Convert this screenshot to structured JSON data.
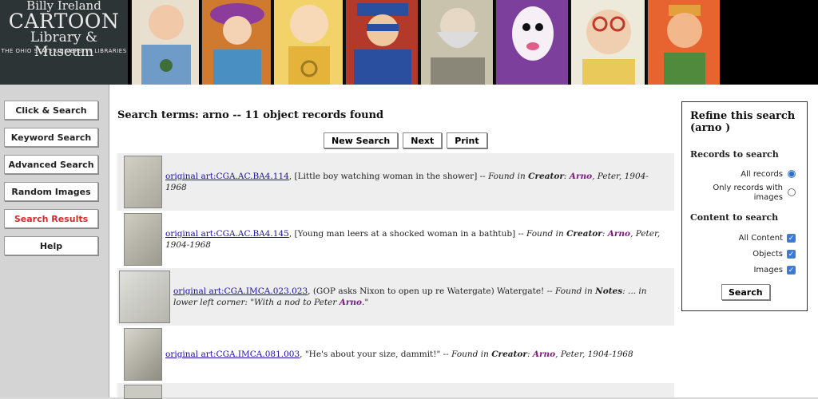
{
  "logo": {
    "line1": "Billy Ireland",
    "line2": "CARTOON",
    "line3": "Library & Museum",
    "line4": "THE OHIO STATE UNIVERSITY LIBRARIES"
  },
  "nav": [
    {
      "label": "Click & Search",
      "active": false
    },
    {
      "label": "Keyword Search",
      "active": false
    },
    {
      "label": "Advanced Search",
      "active": false
    },
    {
      "label": "Random Images",
      "active": false
    },
    {
      "label": "Search Results",
      "active": true
    },
    {
      "label": "Help",
      "active": false
    }
  ],
  "heading": "Search terms: arno -- 11 object records found",
  "buttons": {
    "new_search": "New Search",
    "next": "Next",
    "print": "Print"
  },
  "results": [
    {
      "link": "original art:CGA.AC.BA4.114",
      "desc": ", [Little boy watching woman in the shower] -- ",
      "found": "Found in ",
      "field": "Creator",
      "sep": ": ",
      "hl": "Arno",
      "tail": ", Peter, 1904-1968",
      "tail_italic": true
    },
    {
      "link": "original art:CGA.AC.BA4.145",
      "desc": ", [Young man leers at a shocked woman in a bathtub] -- ",
      "found": "Found in ",
      "field": "Creator",
      "sep": ": ",
      "hl": "Arno",
      "tail": ", Peter, 1904-1968",
      "tail_italic": true
    },
    {
      "link": "original art:CGA.IMCA.023.023",
      "desc": ", (GOP asks Nixon to open up re Watergate) Watergate! -- ",
      "found": "Found in ",
      "field": "Notes",
      "sep": ": ... in lower left corner: \"With a nod to Peter ",
      "hl": "Arno",
      "tail": ".\"",
      "tail_italic": true
    },
    {
      "link": "original art:CGA.IMCA.081.003",
      "desc": ", \"He's about your size, dammit!\" -- ",
      "found": "Found in ",
      "field": "Creator",
      "sep": ": ",
      "hl": "Arno",
      "tail": ", Peter, 1904-1968",
      "tail_italic": true
    }
  ],
  "refine": {
    "title": "Refine this search (arno )",
    "records_heading": "Records to search",
    "all_records": "All records",
    "only_images": "Only records with images",
    "content_heading": "Content to search",
    "all_content": "All Content",
    "objects": "Objects",
    "images": "Images",
    "search_button": "Search"
  }
}
